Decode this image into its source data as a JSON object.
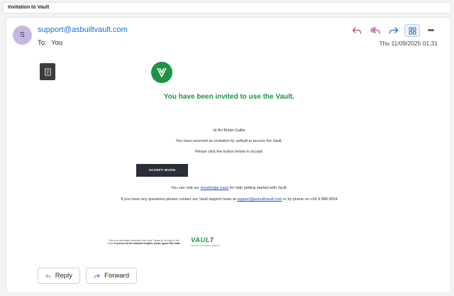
{
  "subject": "Invitation to Vault",
  "header": {
    "avatar_letter": "S",
    "sender": "support@asbuiltvault.com",
    "to_label": "To:",
    "to_value": "You",
    "date": "Thu 11/09/2025 01:31"
  },
  "actions": {
    "icons": [
      "reply-icon",
      "reply-all-icon",
      "forward-icon",
      "apps-icon",
      "more-icon"
    ],
    "more_label": "•••"
  },
  "message": {
    "headline": "You have been invited to use the Vault.",
    "greeting": "Hi Bri Butler-Gallie",
    "line1": "You have received an invitation by asBuilt to access the Vault.",
    "line2": "Please click the button below to accept:",
    "accept_button": "ACCEPT INVITE",
    "help_prefix": "You can visit our",
    "help_link": "knowledge base",
    "help_suffix": "for help getting started with Vault.",
    "contact_prefix": "If you have any questions please contact our Vault support team at",
    "contact_link": "support@asbuiltvault.com",
    "contact_suffix": "or by phone on +64 9 888 4554"
  },
  "footer": {
    "note_1": "This is an automated notification from Vault. Please do not reply to this email.",
    "note_2": "If you are not the intended recipient, please ignore this email.",
    "brand": "VAULT",
    "brand_sub": "TECHNICAL INTELLIGENCE"
  },
  "buttons": {
    "reply": "Reply",
    "forward": "Forward"
  },
  "colors": {
    "accent_blue": "#1a6ec7",
    "vault_green": "#1f9244",
    "dark_button": "#2a2f38",
    "reply_icon": "#b04a8f"
  }
}
